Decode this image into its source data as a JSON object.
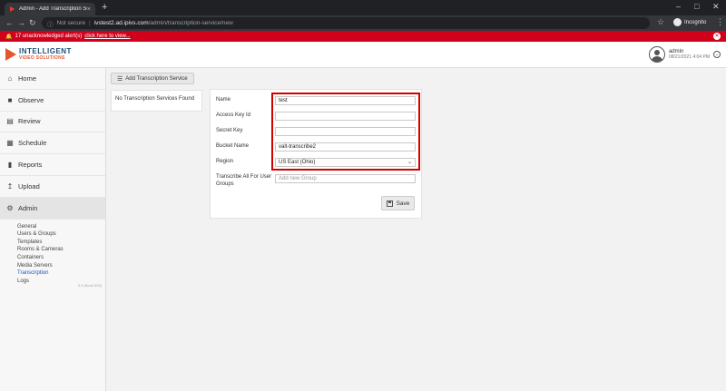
{
  "browser": {
    "tab_title": "Admin - Add Transcription Service",
    "tab_close": "×",
    "new_tab": "+",
    "security": "Not secure",
    "url_host": "ivstest2.ad.ipivs.com",
    "url_path": "/admin/transcription-service/new",
    "incognito_label": "Incognito"
  },
  "alert": {
    "text": "17 unacknowledged alert(s)",
    "link": "click here to view..."
  },
  "header": {
    "logo_line1": "INTELLIGENT",
    "logo_line2": "VIDEO SOLUTIONS",
    "user_name": "admin",
    "user_time": "08/21/2021 4:04 PM"
  },
  "sidebar": {
    "items": [
      {
        "label": "Home",
        "icon": "home-icon"
      },
      {
        "label": "Observe",
        "icon": "video-camera-icon"
      },
      {
        "label": "Review",
        "icon": "film-icon"
      },
      {
        "label": "Schedule",
        "icon": "calendar-icon"
      },
      {
        "label": "Reports",
        "icon": "bar-chart-icon"
      },
      {
        "label": "Upload",
        "icon": "upload-icon"
      },
      {
        "label": "Admin",
        "icon": "gear-icon"
      }
    ],
    "sub_items": [
      "General",
      "Users & Groups",
      "Templates",
      "Rooms & Cameras",
      "Containers",
      "Media Servers",
      "Transcription",
      "Logs"
    ],
    "current_sub": "Transcription",
    "version": "5.5 (Build 698)"
  },
  "main": {
    "add_button": "Add Transcription Service",
    "empty_list": "No Transcription Services Found",
    "form": {
      "name_label": "Name",
      "name_value": "test",
      "access_key_label": "Access Key Id",
      "access_key_value": "",
      "secret_key_label": "Secret Key",
      "secret_key_value": "",
      "bucket_label": "Bucket Name",
      "bucket_value": "valt-transcribe2",
      "region_label": "Region",
      "region_value": "US East (Ohio)",
      "groups_label": "Transcribe All For User Groups",
      "groups_placeholder": "Add new Group",
      "save_label": "Save"
    }
  },
  "colors": {
    "alert_bar": "#d0021b",
    "highlight": "#d40000",
    "link": "#1a56c9"
  }
}
